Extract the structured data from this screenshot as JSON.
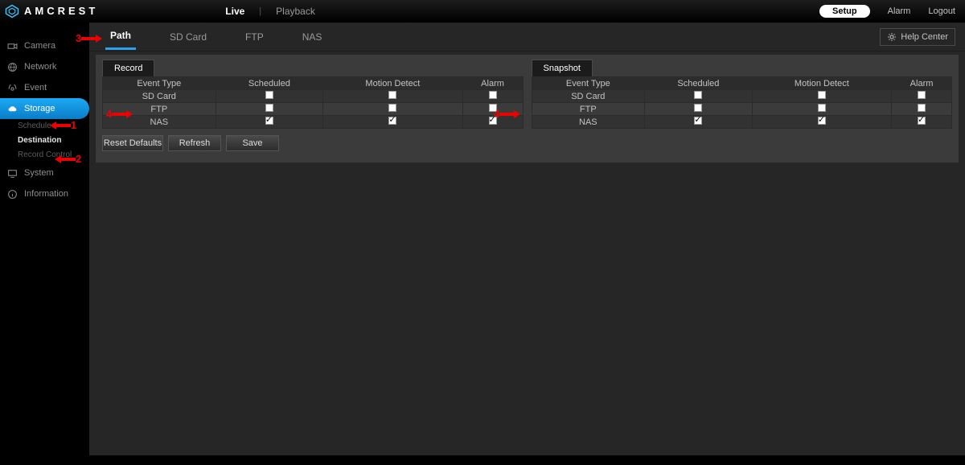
{
  "brand": "AMCREST",
  "main_tabs": {
    "live": "Live",
    "playback": "Playback"
  },
  "topright": {
    "setup": "Setup",
    "alarm": "Alarm",
    "logout": "Logout"
  },
  "sidebar": {
    "camera": "Camera",
    "network": "Network",
    "event": "Event",
    "storage": "Storage",
    "storage_sub": {
      "schedule": "Schedule",
      "destination": "Destination",
      "record_control": "Record Control"
    },
    "system": "System",
    "information": "Information"
  },
  "subtabs": {
    "path": "Path",
    "sdcard": "SD Card",
    "ftp": "FTP",
    "nas": "NAS"
  },
  "help": "Help Center",
  "tables": {
    "record_caption": "Record",
    "snapshot_caption": "Snapshot",
    "headers": {
      "event_type": "Event Type",
      "scheduled": "Scheduled",
      "motion": "Motion Detect",
      "alarm": "Alarm"
    },
    "rows": {
      "sdcard": "SD Card",
      "ftp": "FTP",
      "nas": "NAS"
    }
  },
  "buttons": {
    "reset": "Reset Defaults",
    "refresh": "Refresh",
    "save": "Save"
  },
  "anno": {
    "one": "1",
    "two": "2",
    "three": "3",
    "four": "4"
  },
  "checks": {
    "record": {
      "sdcard": {
        "scheduled": false,
        "motion": false,
        "alarm": false
      },
      "ftp": {
        "scheduled": false,
        "motion": false,
        "alarm": false
      },
      "nas": {
        "scheduled": true,
        "motion": true,
        "alarm": true
      }
    },
    "snapshot": {
      "sdcard": {
        "scheduled": false,
        "motion": false,
        "alarm": false
      },
      "ftp": {
        "scheduled": false,
        "motion": false,
        "alarm": false
      },
      "nas": {
        "scheduled": true,
        "motion": true,
        "alarm": true
      }
    }
  }
}
